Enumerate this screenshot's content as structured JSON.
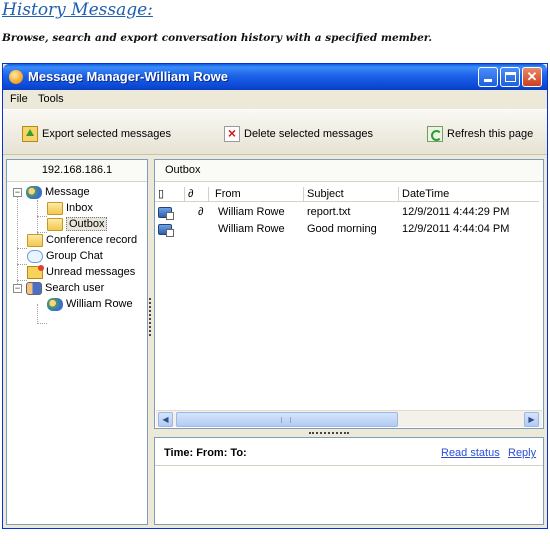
{
  "doc": {
    "title": "History Message:",
    "subtitle": "Browse, search and export conversation history with a specified member."
  },
  "window": {
    "title": "Message Manager-William Rowe",
    "controls": {
      "minimize": "minimize",
      "maximize": "maximize",
      "close": "✕"
    }
  },
  "menu": {
    "file": "File",
    "tools": "Tools"
  },
  "toolbar": {
    "export_label": "Export selected messages",
    "delete_label": "Delete selected messages",
    "refresh_label": "Refresh this page"
  },
  "left_pane": {
    "header": "192.168.186.1",
    "tree": {
      "message": "Message",
      "inbox": "Inbox",
      "outbox": "Outbox",
      "conference": "Conference record",
      "group_chat": "Group Chat",
      "unread": "Unread messages",
      "search_user": "Search user",
      "user": "William Rowe"
    }
  },
  "right_pane": {
    "header": "Outbox",
    "columns": {
      "from": "From",
      "subject": "Subject",
      "datetime": "DateTime"
    },
    "rows": [
      {
        "from": "William Rowe",
        "subject": "report.txt",
        "datetime": "12/9/2011 4:44:29 PM",
        "attachment": true
      },
      {
        "from": "William Rowe",
        "subject": "Good morning",
        "datetime": "12/9/2011 4:44:04 PM",
        "attachment": false
      }
    ]
  },
  "detail": {
    "label": "Time: From: To:",
    "read_status": "Read status",
    "reply": "Reply"
  },
  "colors": {
    "titlebar": "#0a49d6",
    "link": "#2a4fd8",
    "heading": "#1f5fb0"
  }
}
